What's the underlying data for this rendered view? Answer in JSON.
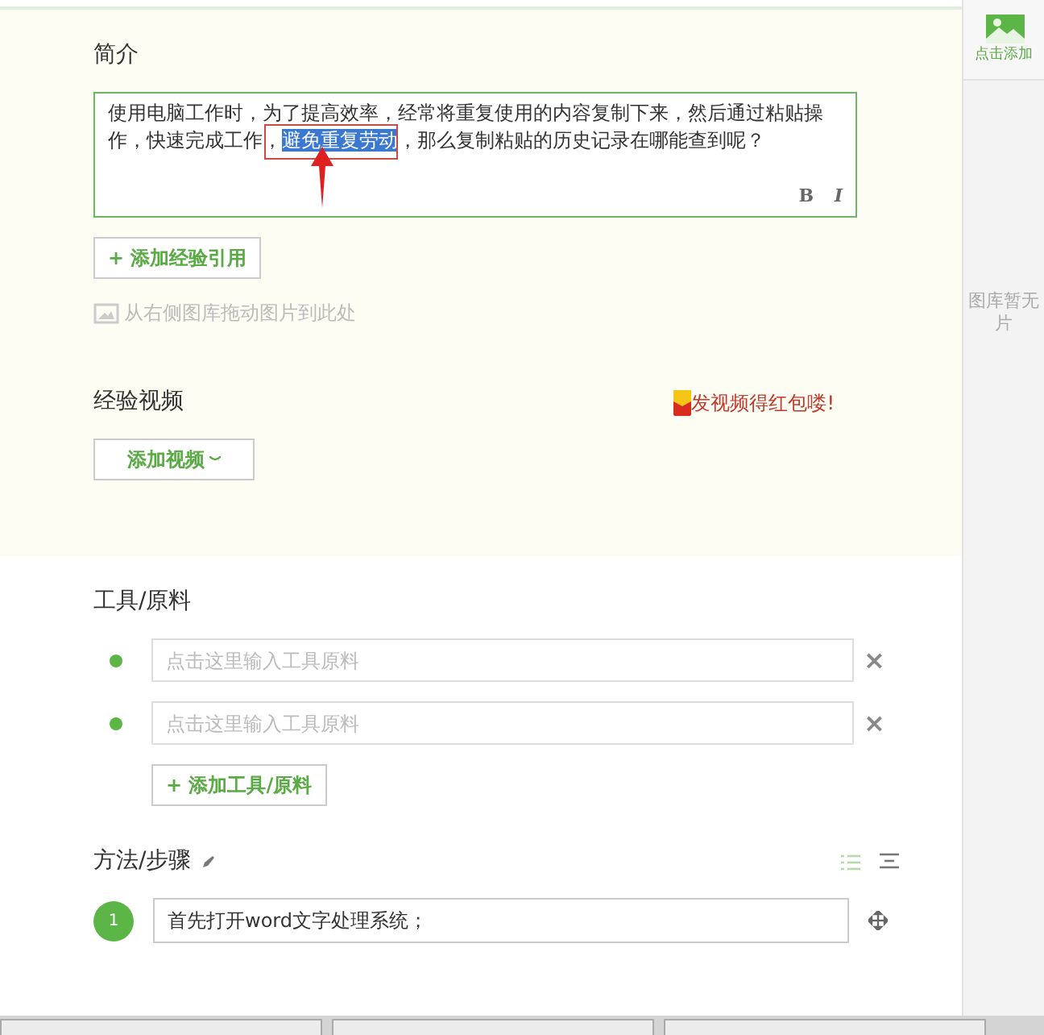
{
  "intro": {
    "heading": "简介",
    "text_before": "使用电脑工作时，为了提高效率，经常将重复使用的内容复制下来，然后通过粘贴操作，快速完成工作，",
    "text_selected": "避免重复劳动",
    "text_after": "，那么复制粘贴的历史记录在哪能查到呢？",
    "format_buttons": [
      "B",
      "I"
    ],
    "add_reference": {
      "icon": "+",
      "label": "添加经验引用"
    },
    "drop_hint": "从右侧图库拖动图片到此处"
  },
  "video": {
    "heading": "经验视频",
    "promo": "发视频得红包喽!",
    "add_button": "添加视频"
  },
  "tools": {
    "heading": "工具/原料",
    "items": [
      {
        "placeholder": "点击这里输入工具原料",
        "remove": "×"
      },
      {
        "placeholder": "点击这里输入工具原料",
        "remove": "×"
      }
    ],
    "add_button": {
      "icon": "+",
      "label": "添加工具/原料"
    }
  },
  "steps": {
    "heading": "方法/步骤",
    "items": [
      {
        "number": "1",
        "text": "首先打开word文字处理系统；"
      }
    ]
  },
  "gallery": {
    "add_label": "点击添加",
    "empty_text": "图库暂无片"
  }
}
